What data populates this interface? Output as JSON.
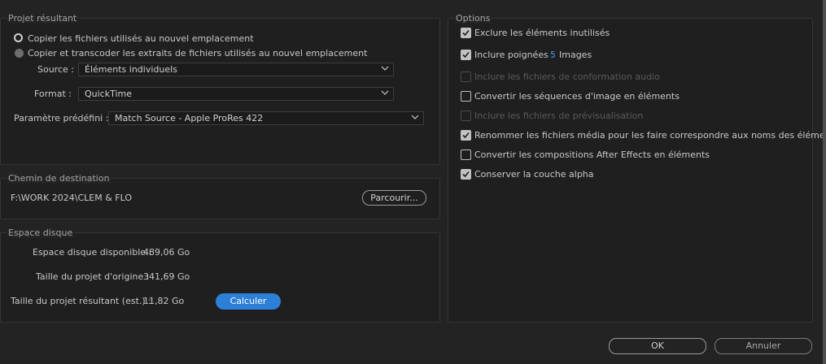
{
  "projet": {
    "title": "Projet résultant",
    "radio1_label": "Copier les fichiers utilisés au nouvel emplacement",
    "radio2_label": "Copier et transcoder les extraits de fichiers utilisés au nouvel emplacement",
    "source_label": "Source :",
    "source_value": "Éléments individuels",
    "format_label": "Format :",
    "format_value": "QuickTime",
    "preset_label": "Paramètre prédéfini :",
    "preset_value": "Match Source - Apple ProRes 422"
  },
  "destination": {
    "title": "Chemin de destination",
    "path": "F:\\WORK 2024\\CLEM & FLO",
    "browse_label": "Parcourir..."
  },
  "disk": {
    "title": "Espace disque",
    "available_label": "Espace disque disponible :",
    "available_value": "489,06 Go",
    "original_label": "Taille du projet d'origine :",
    "original_value": "341,69 Go",
    "result_label": "Taille du projet résultant (est.) :",
    "result_value": "11,82 Go",
    "compute_label": "Calculer"
  },
  "options": {
    "title": "Options",
    "items": [
      {
        "label": "Exclure les éléments inutilisés",
        "state": "checked"
      },
      {
        "label": "Inclure poignées :",
        "state": "checked"
      },
      {
        "label": "Inclure les fichiers de conformation audio",
        "state": "disabled"
      },
      {
        "label": "Convertir les séquences d'image en éléments",
        "state": "unchecked"
      },
      {
        "label": "Inclure les fichiers de prévisualisation",
        "state": "disabled"
      },
      {
        "label": "Renommer les fichiers média pour les faire correspondre aux noms des éléments",
        "state": "checked"
      },
      {
        "label": "Convertir les compositions After Effects en éléments",
        "state": "unchecked"
      },
      {
        "label": "Conserver la couche alpha",
        "state": "checked"
      }
    ],
    "handles_value": "5",
    "handles_unit": "Images"
  },
  "footer": {
    "ok_label": "OK",
    "cancel_label": "Annuler"
  },
  "colors": {
    "accent": "#2d80d8",
    "link_value": "#3d8fe6",
    "background": "#232323"
  }
}
